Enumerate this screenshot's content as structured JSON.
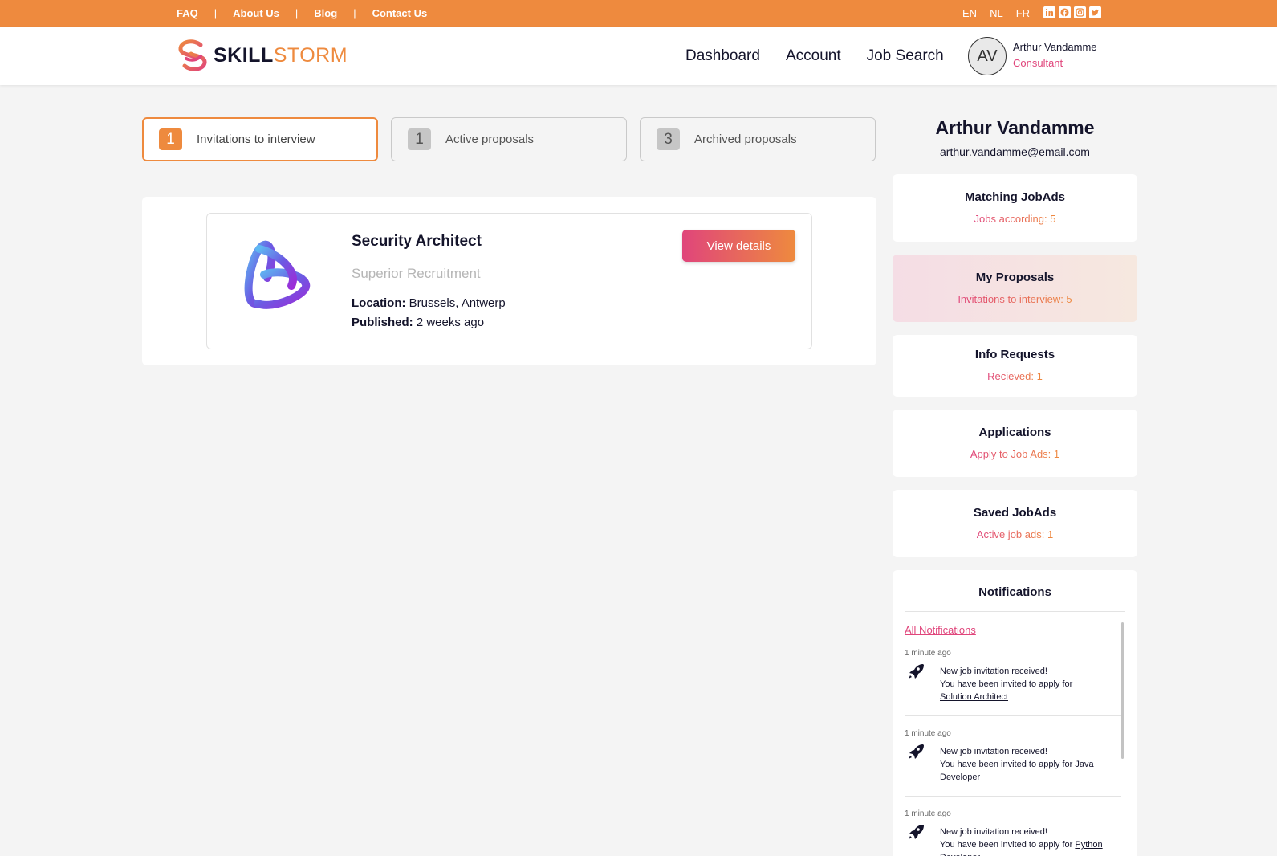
{
  "topbar": {
    "links": [
      "FAQ",
      "About Us",
      "Blog",
      "Contact Us"
    ],
    "separator": "|",
    "languages": [
      "EN",
      "NL",
      "FR"
    ],
    "social_icons": [
      "linkedin-icon",
      "facebook-icon",
      "instagram-icon",
      "twitter-icon"
    ]
  },
  "header": {
    "brand_part1": "SKILL",
    "brand_part2": "STORM",
    "nav": [
      "Dashboard",
      "Account",
      "Job Search"
    ],
    "avatar_initials": "AV",
    "user_name": "Arthur Vandamme",
    "user_role": "Consultant"
  },
  "tabs": [
    {
      "count": "1",
      "label": "Invitations to interview",
      "active": true
    },
    {
      "count": "1",
      "label": "Active proposals",
      "active": false
    },
    {
      "count": "3",
      "label": "Archived proposals",
      "active": false
    }
  ],
  "job": {
    "title": "Security Architect",
    "company": "Superior Recruitment",
    "location_label": "Location:",
    "location": "Brussels, Antwerp",
    "published_label": "Published:",
    "published": "2 weeks ago",
    "button": "View details"
  },
  "profile": {
    "name": "Arthur Vandamme",
    "email": "arthur.vandamme@email.com"
  },
  "stats": [
    {
      "title": "Matching JobAds",
      "value": "Jobs according: 5"
    },
    {
      "title": "My Proposals",
      "value": "Invitations to interview: 5"
    },
    {
      "title": "Info Requests",
      "value": "Recieved: 1"
    },
    {
      "title": "Applications",
      "value": "Apply to Job Ads: 1"
    },
    {
      "title": "Saved JobAds",
      "value": "Active job ads: 1"
    }
  ],
  "notifications": {
    "title": "Notifications",
    "all_label": "All Notifications",
    "items": [
      {
        "time": "1 minute ago",
        "line1": "New job invitation received!",
        "line2": "You have been invited to apply for",
        "job": "Solution Architect"
      },
      {
        "time": "1 minute ago",
        "line1": "New job invitation received!",
        "line2": "You have been invited to apply for",
        "job": "Java Developer"
      },
      {
        "time": "1 minute ago",
        "line1": "New job invitation received!",
        "line2": "You have been invited to apply for",
        "job": "Python Developer"
      }
    ]
  },
  "colors": {
    "accent_orange": "#ee8a3e",
    "accent_pink": "#e0457b",
    "text_dark": "#14142b",
    "background": "#f4f4f4"
  }
}
